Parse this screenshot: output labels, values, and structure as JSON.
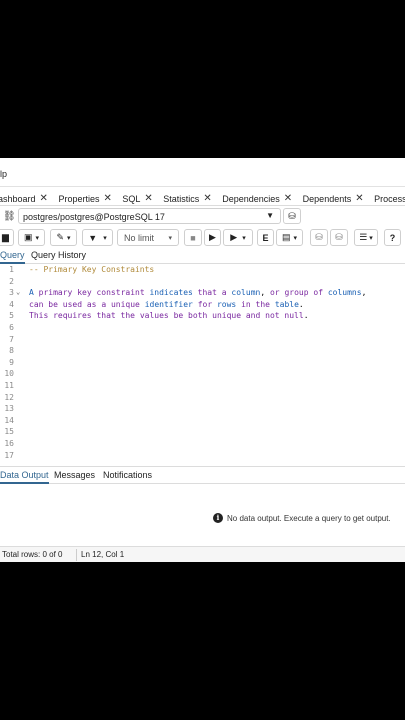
{
  "menu": {
    "help_label": "lp"
  },
  "tabs": [
    {
      "label": "ashboard",
      "close": "✕"
    },
    {
      "label": "Properties",
      "close": "✕"
    },
    {
      "label": "SQL",
      "close": "✕"
    },
    {
      "label": "Statistics",
      "close": "✕"
    },
    {
      "label": "Dependencies",
      "close": "✕"
    },
    {
      "label": "Dependents",
      "close": "✕"
    },
    {
      "label": "Processes",
      "close": "✕"
    }
  ],
  "connection": {
    "value": "postgres/postgres@PostgreSQL 17"
  },
  "toolbar": {
    "limit_value": "No limit",
    "explain_label": "E"
  },
  "query_tabs": {
    "query": "Query",
    "history": "Query History"
  },
  "editor": {
    "line_numbers": [
      "1",
      "2",
      "3",
      "4",
      "5",
      "6",
      "7",
      "8",
      "9",
      "10",
      "11",
      "12",
      "13",
      "14",
      "15",
      "16",
      "17"
    ],
    "comment": "-- Primary Key Constraints",
    "line3": [
      "A",
      "primary",
      "key",
      "constraint",
      "indicates",
      "that",
      "a",
      "column",
      ",",
      "or",
      "group",
      "of",
      "columns",
      ","
    ],
    "line4": [
      "can",
      "be",
      "used",
      "as",
      "a",
      "unique",
      "identifier",
      "for",
      "rows",
      "in",
      "the",
      "table",
      "."
    ],
    "line5": [
      "This",
      "requires",
      "that",
      "the",
      "values",
      "be",
      "both",
      "unique",
      "and",
      "not",
      "null",
      "."
    ]
  },
  "output_tabs": {
    "data_output": "Data Output",
    "messages": "Messages",
    "notifications": "Notifications"
  },
  "output": {
    "message": "No data output. Execute a query to get output."
  },
  "status": {
    "total_rows": "Total rows: 0 of 0",
    "position": "Ln 12, Col 1"
  },
  "colors": {
    "accent": "#326690",
    "keyword": "#7a28a0",
    "comment": "#b08a3a",
    "identifier": "#1a60b4"
  }
}
